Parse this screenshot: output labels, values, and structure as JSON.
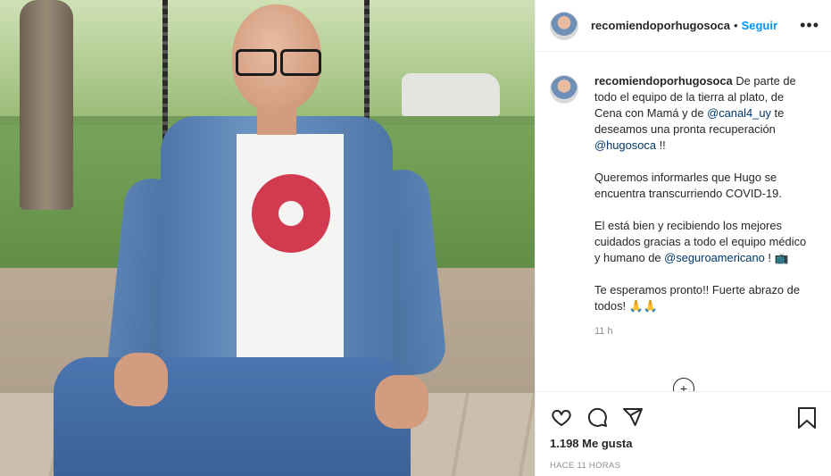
{
  "header": {
    "username": "recomiendoporhugosoca",
    "separator": "•",
    "follow_label": "Seguir",
    "more_label": "•••"
  },
  "caption": {
    "username": "recomiendoporhugosoca",
    "p1_text_a": "De parte de todo el equipo de la tierra al plato, de Cena con Mamá y de ",
    "p1_mention_a": "@canal4_uy",
    "p1_text_b": " te deseamos una pronta recuperación ",
    "p1_mention_b": "@hugosoca",
    "p1_text_c": " !!",
    "p2": "Queremos informarles que Hugo se encuentra transcurriendo COVID-19.",
    "p3_text": "El está bien y recibiendo los mejores cuidados gracias a todo el equipo médico y humano de ",
    "p3_mention": "@seguroamericano",
    "p3_end": " ! 📺",
    "p4": "Te esperamos pronto!! Fuerte abrazo de todos! 🙏🙏",
    "time": "11 h"
  },
  "load_more_label": "+",
  "actions": {
    "like_icon": "heart-icon",
    "comment_icon": "comment-icon",
    "share_icon": "paper-plane-icon",
    "save_icon": "bookmark-icon"
  },
  "likes": "1.198 Me gusta",
  "posted_ago": "HACE 11 HORAS"
}
